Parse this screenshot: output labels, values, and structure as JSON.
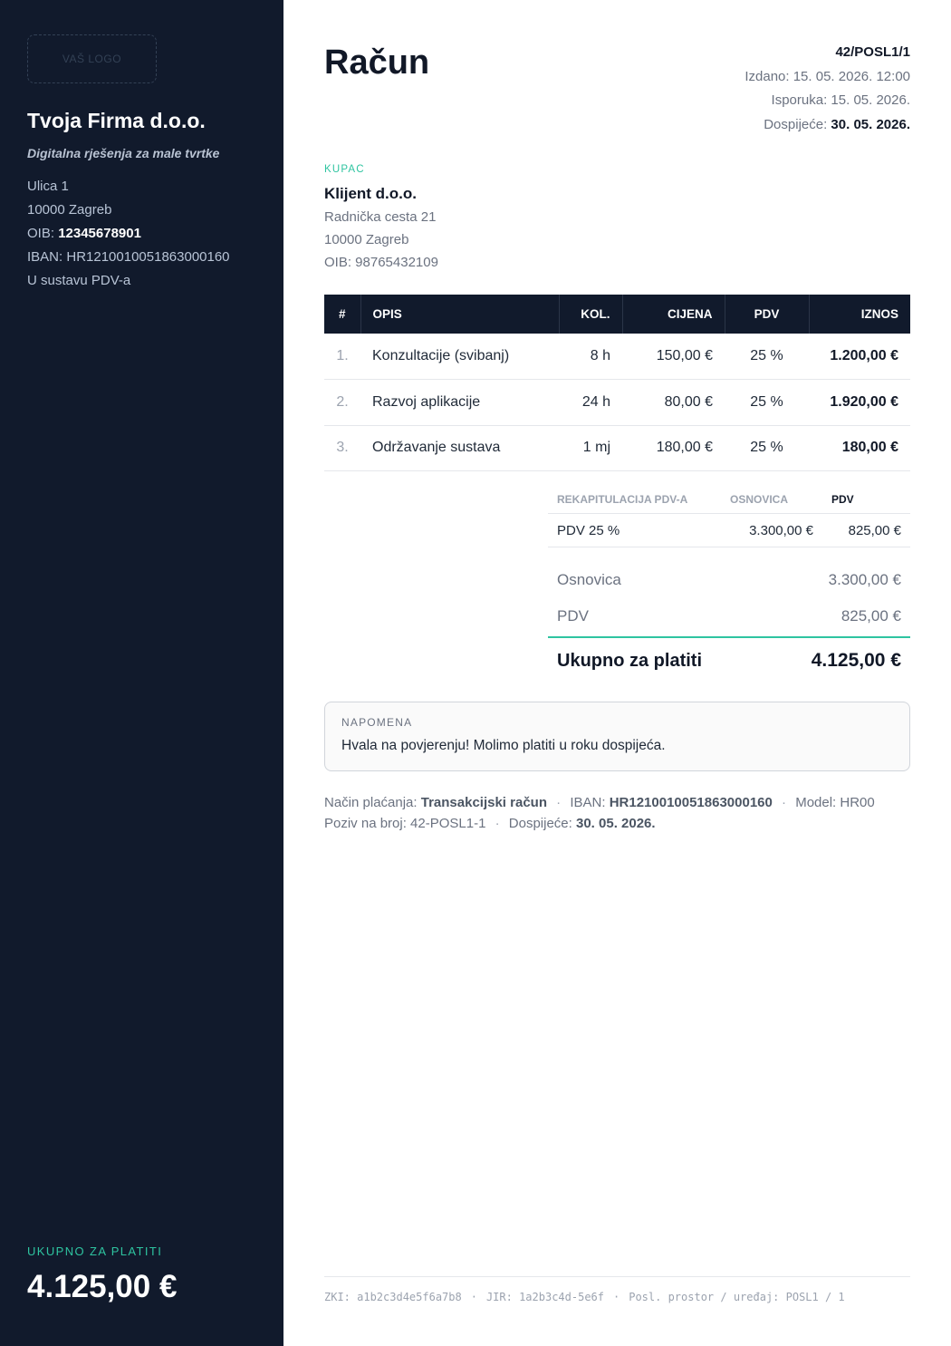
{
  "seller": {
    "logo_placeholder": "VAŠ LOGO",
    "name": "Tvoja Firma d.o.o.",
    "tagline": "Digitalna rješenja za male tvrtke",
    "street": "Ulica 1",
    "city": "10000 Zagreb",
    "oib_label": "OIB: ",
    "oib": "12345678901",
    "iban_label": "IBAN: ",
    "iban": "HR1210010051863000160",
    "vat_status": "U sustavu PDV-a",
    "total_label": "UKUPNO ZA PLATITI",
    "total_value": "4.125,00 €"
  },
  "invoice": {
    "title": "Račun",
    "number": "42/POSL1/1",
    "issued_label": "Izdano: ",
    "issued": "15. 05. 2026. 12:00",
    "delivery_label": "Isporuka: ",
    "delivery": "15. 05. 2026.",
    "due_label": "Dospijeće: ",
    "due": "30. 05. 2026."
  },
  "buyer": {
    "label": "KUPAC",
    "name": "Klijent d.o.o.",
    "street": "Radnička cesta 21",
    "city": "10000 Zagreb",
    "oib": "OIB: 98765432109"
  },
  "items_table": {
    "headers": [
      "#",
      "OPIS",
      "KOL.",
      "CIJENA",
      "PDV",
      "IZNOS"
    ],
    "rows": [
      {
        "idx": "1.",
        "desc": "Konzultacije (svibanj)",
        "qty": "8 h",
        "price": "150,00 €",
        "vat": "25 %",
        "amount": "1.200,00 €"
      },
      {
        "idx": "2.",
        "desc": "Razvoj aplikacije",
        "qty": "24 h",
        "price": "80,00 €",
        "vat": "25 %",
        "amount": "1.920,00 €"
      },
      {
        "idx": "3.",
        "desc": "Održavanje sustava",
        "qty": "1 mj",
        "price": "180,00 €",
        "vat": "25 %",
        "amount": "180,00 €"
      }
    ]
  },
  "vat_recap": {
    "headers": [
      "REKAPITULACIJA PDV-A",
      "OSNOVICA",
      "PDV"
    ],
    "rows": [
      {
        "rate": "PDV 25 %",
        "base": "3.300,00 €",
        "vat": "825,00 €"
      }
    ]
  },
  "totals": {
    "base_label": "Osnovica",
    "base": "3.300,00 €",
    "vat_label": "PDV",
    "vat": "825,00 €",
    "grand_label": "Ukupno za platiti",
    "grand": "4.125,00 €"
  },
  "note": {
    "label": "NAPOMENA",
    "text": "Hvala na povjerenju! Molimo platiti u roku dospijeća."
  },
  "payment": {
    "method_label": "Način plaćanja: ",
    "method": "Transakcijski račun",
    "iban_label": "IBAN: ",
    "iban": "HR1210010051863000160",
    "model": "Model: HR00",
    "reference": "Poziv na broj: 42-POSL1-1",
    "due_label": "Dospijeće: ",
    "due": "30. 05. 2026.",
    "separator": "·"
  },
  "fiscal": {
    "zki": "ZKI: a1b2c3d4e5f6a7b8",
    "jir": "JIR: 1a2b3c4d-5e6f",
    "premises": "Posl. prostor / uređaj: POSL1 / 1",
    "separator": "·"
  },
  "colors": {
    "sidebar_bg": "#111a2c",
    "accent": "#2ec4a0",
    "text_dark": "#111827"
  }
}
